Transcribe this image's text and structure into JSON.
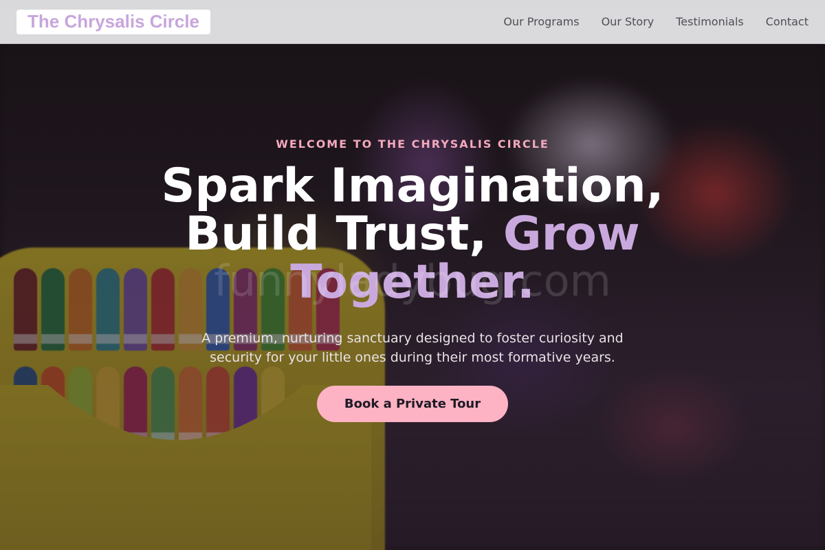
{
  "header": {
    "brand": "The Chrysalis Circle",
    "nav": [
      {
        "label": "Our Programs"
      },
      {
        "label": "Our Story"
      },
      {
        "label": "Testimonials"
      },
      {
        "label": "Contact"
      }
    ]
  },
  "hero": {
    "eyebrow": "WELCOME TO THE CHRYSALIS CIRCLE",
    "headline_part1": "Spark Imagination, Build Trust, ",
    "headline_accent": "Grow Together.",
    "subtext": "A premium, nurturing sanctuary designed to foster curiosity and security for your little ones during their most formative years.",
    "cta_label": "Book a Private Tour",
    "watermark": "funnyladybug.com"
  },
  "colors": {
    "brand": "#c8a6dc",
    "accent_lavender": "#c9a9dd",
    "eyebrow_pink": "#f5a9bd",
    "cta_pink": "#fdb3c4",
    "header_bg": "#e2e2e4"
  }
}
